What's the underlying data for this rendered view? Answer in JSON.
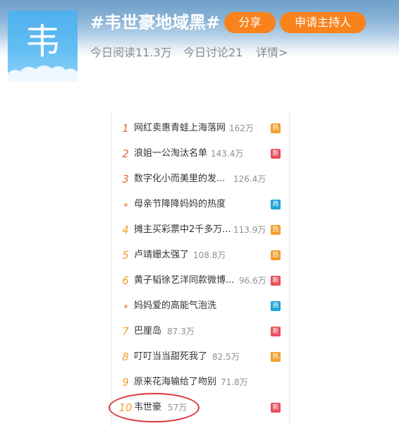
{
  "topic": {
    "avatar_char": "韦",
    "title": "#韦世豪地域黑#",
    "share_label": "分享",
    "host_label": "申请主持人",
    "reads": "今日阅读11.3万",
    "discussions": "今日讨论21",
    "detail_link": "详情>"
  },
  "colors": {
    "accent_orange": "#f8821c",
    "hot_badge": "#f0a02f",
    "new_badge": "#e8505b",
    "business_badge": "#1fa3d9",
    "highlight_red": "#d9383f"
  },
  "hot_list": [
    {
      "rank": "1",
      "title": "网红卖惠青蛙上海落网",
      "count": "162万",
      "badge": "热"
    },
    {
      "rank": "2",
      "title": "浪姐一公淘汰名单",
      "count": "143.4万",
      "badge": "新"
    },
    {
      "rank": "3",
      "title": "数字化小而美里的发...",
      "count": "126.4万",
      "badge": ""
    },
    {
      "rank": "",
      "title": "母亲节降降妈妈的热度",
      "count": "",
      "badge": "商"
    },
    {
      "rank": "4",
      "title": "摊主买彩票中2千多万...",
      "count": "113.9万",
      "badge": "热"
    },
    {
      "rank": "5",
      "title": "卢靖姗太强了",
      "count": "108.8万",
      "badge": "热"
    },
    {
      "rank": "6",
      "title": "黄子韬徐艺洋同款微博...",
      "count": "96.6万",
      "badge": "新"
    },
    {
      "rank": "",
      "title": "妈妈爱的高能气泡洗",
      "count": "",
      "badge": "商"
    },
    {
      "rank": "7",
      "title": "巴厘岛",
      "count": "87.3万",
      "badge": "新"
    },
    {
      "rank": "8",
      "title": "叮叮当当甜死我了",
      "count": "82.5万",
      "badge": "热"
    },
    {
      "rank": "9",
      "title": "原来花海输给了吻别",
      "count": "71.8万",
      "badge": ""
    },
    {
      "rank": "10",
      "title": "韦世豪",
      "count": "57万",
      "badge": "新"
    }
  ]
}
